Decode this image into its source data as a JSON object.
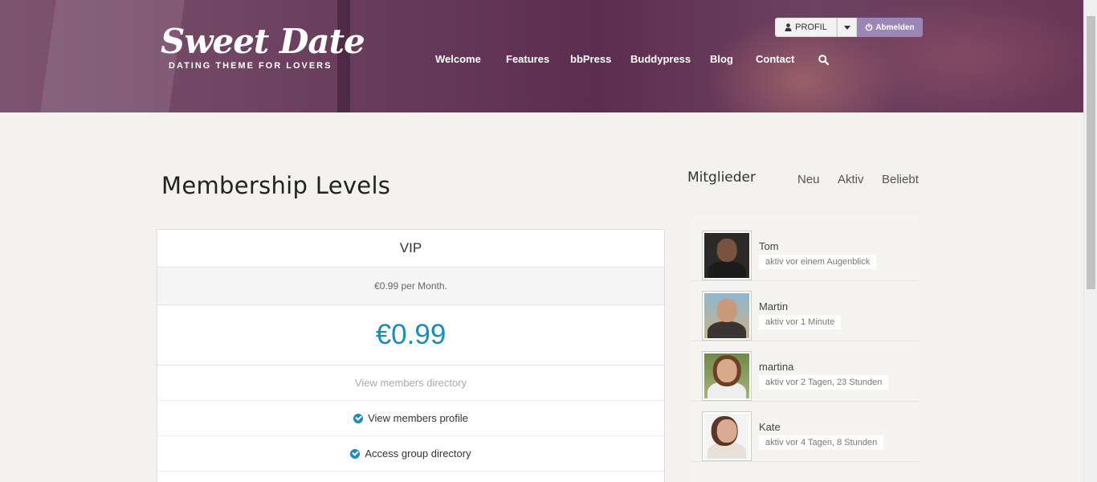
{
  "header": {
    "logo_title": "Sweet Date",
    "logo_subtitle": "DATING THEME FOR LOVERS",
    "nav": [
      "Welcome",
      "Features",
      "bbPress",
      "Buddypress",
      "Blog",
      "Contact"
    ],
    "profile_button": "PROFIL",
    "logout_button": "Abmelden",
    "accent_color": "#9b86b5"
  },
  "main": {
    "page_title": "Membership Levels",
    "level": {
      "name": "VIP",
      "description": "€0.99 per Month.",
      "price": "€0.99",
      "features": [
        {
          "label": "View members directory",
          "enabled": false
        },
        {
          "label": "View members profile",
          "enabled": true
        },
        {
          "label": "Access group directory",
          "enabled": true
        }
      ]
    }
  },
  "sidebar": {
    "title": "Mitglieder",
    "tabs": [
      "Neu",
      "Aktiv",
      "Beliebt"
    ],
    "members": [
      {
        "name": "Tom",
        "status": "aktiv vor einem Augenblick"
      },
      {
        "name": "Martin",
        "status": "aktiv vor 1 Minute"
      },
      {
        "name": "martina",
        "status": "aktiv vor 2 Tagen, 23 Stunden"
      },
      {
        "name": "Kate",
        "status": "aktiv vor 4 Tagen, 8 Stunden"
      }
    ]
  },
  "colors": {
    "price_blue": "#1b8bbd",
    "header_purple": "#6b3e5e"
  }
}
